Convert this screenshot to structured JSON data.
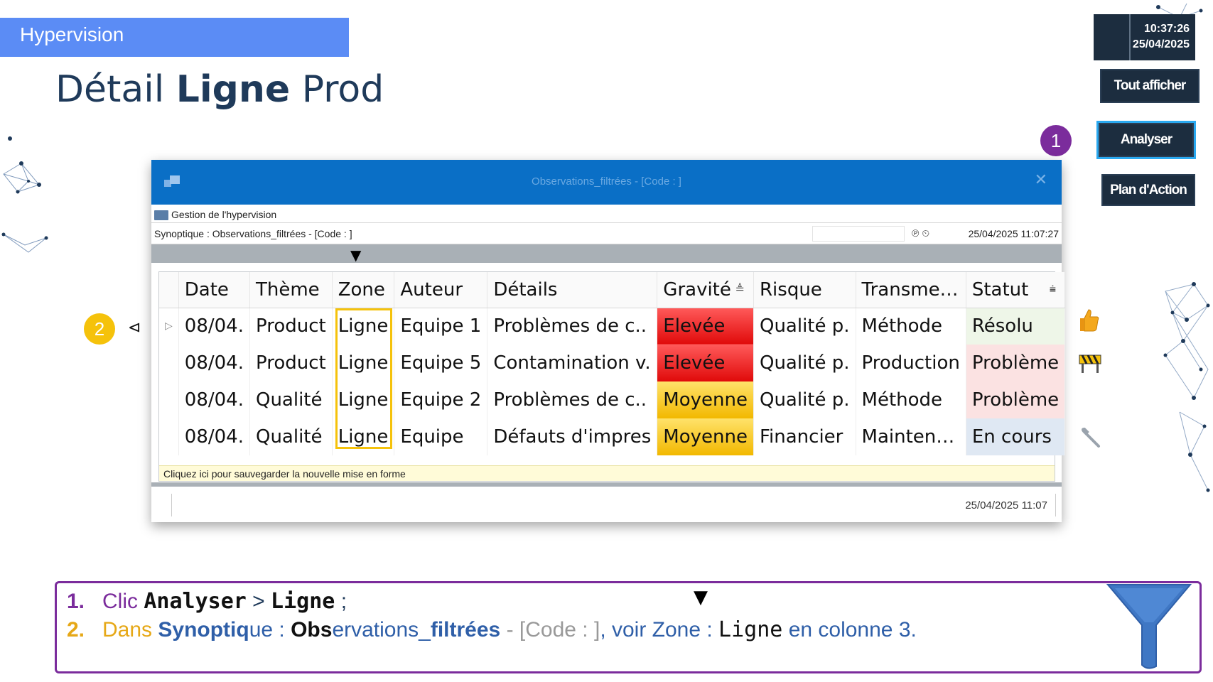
{
  "header": {
    "section": "Hypervision"
  },
  "title": {
    "part1": "Détail ",
    "bold": "Ligne",
    "part2": " Prod"
  },
  "clock": {
    "time": "10:37:26",
    "date": "25/04/2025"
  },
  "side_buttons": {
    "show_all": "Tout afficher",
    "analyze": "Analyser",
    "action_plan": "Plan d'Action"
  },
  "badges": {
    "one": "1",
    "two": "2"
  },
  "dialog": {
    "title": "Observations_filtrées - [Code : ]",
    "close": "✕",
    "menu": "Gestion de l'hypervision",
    "breadcrumb": "Synoptique : Observations_filtrées - [Code : ]",
    "crumb_icons": "℗  ⏲",
    "crumb_date": "25/04/2025 11:07:27",
    "save_note": "Cliquez ici pour sauvegarder la nouvelle mise en forme",
    "status_date": "25/04/2025 11:07"
  },
  "grid": {
    "columns": [
      "Date",
      "Thème",
      "Zone",
      "Auteur",
      "Détails",
      "Gravité",
      "Risque",
      "Transme…",
      "Statut"
    ],
    "rows": [
      [
        "08/04.",
        "Product",
        "Ligne",
        "Equipe 1",
        "Problèmes de c..",
        "Elevée",
        "Qualité p.",
        "Méthode",
        "Résolu"
      ],
      [
        "08/04.",
        "Product",
        "Ligne",
        "Equipe 5",
        "Contamination v.",
        "Elevée",
        "Qualité p.",
        "Production",
        "Problème"
      ],
      [
        "08/04.",
        "Qualité",
        "Ligne",
        "Equipe 2",
        "Problèmes de c..",
        "Moyenne",
        "Qualité p.",
        "Méthode",
        "Problème"
      ],
      [
        "08/04.",
        "Qualité",
        "Ligne",
        "Equipe",
        "Défauts d'impres",
        "Moyenne",
        "Financier",
        "Mainten…",
        "En cours"
      ]
    ]
  },
  "row_icons": [
    "thumbs-up-icon",
    "barrier-icon",
    "",
    "wrench-icon"
  ],
  "instructions": {
    "l1_num": "1.",
    "l1_a": "Clic ",
    "l1_b": "Analyser",
    "l1_c": " > ",
    "l1_d": "Ligne",
    "l1_e": " ;",
    "l2_num": "2.",
    "l2_a": "Dans ",
    "l2_b": "Synoptiq",
    "l2_c": "ue : ",
    "l2_d": "Obs",
    "l2_e": "ervations_",
    "l2_f": "filtrées",
    "l2_g": " - [Code : ]",
    "l2_h": ", voir Zone : ",
    "l2_i": "Ligne",
    "l2_j": " en colonne 3."
  },
  "colors": {
    "accent": "#5b8cf5",
    "titlebar": "#0a6fc6",
    "high": "#e00a0a",
    "medium": "#f2b800",
    "purple": "#7b2c9c",
    "gold": "#e6a817"
  }
}
